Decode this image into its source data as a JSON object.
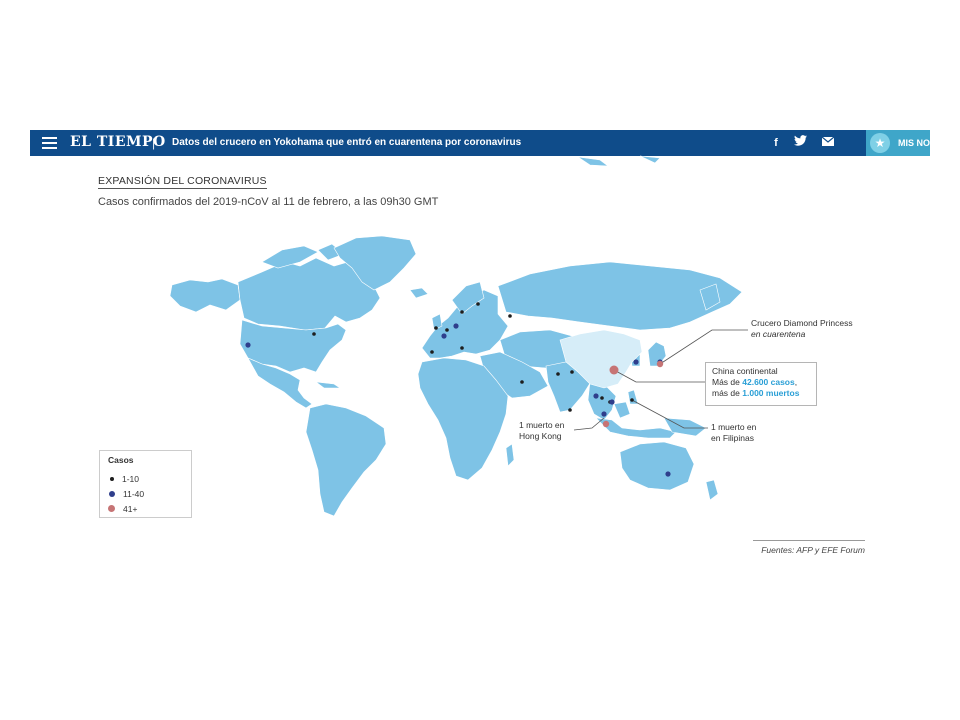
{
  "topbar": {
    "brand": "EL TIEMPO",
    "separator": "|",
    "headline": "Datos del crucero en Yokohama que entró en cuarentena por coronavirus",
    "facebook_icon": "facebook-icon",
    "twitter_icon": "twitter-icon",
    "mail_icon": "mail-icon",
    "mis_noticias_label": "MIS NO",
    "colors": {
      "bar": "#0f4c8a",
      "accent": "#3fa6c9"
    }
  },
  "card": {
    "title": "EXPANSIÓN DEL CORONAVIRUS",
    "subtitle": "Casos confirmados del 2019-nCoV al 11 de febrero, a las 09h30 GMT"
  },
  "map": {
    "colors": {
      "land": "#7ec3e6",
      "china": "#d6edf8",
      "small": "#1e1e1e",
      "medium": "#2f3e8c",
      "large": "#c67475"
    }
  },
  "callouts": {
    "diamond_line1": "Crucero Diamond Princess",
    "diamond_line2": "en cuarentena",
    "china_line1": "China continental",
    "china_line2_pre": "Más de ",
    "china_cases": "42.600 casos",
    "china_line2_post": ",",
    "china_line3_pre": "más de ",
    "china_deaths": "1.000 muertos",
    "hk_line1": "1 muerto en",
    "hk_line2": "Hong Kong",
    "ph_line1": "1 muerto en",
    "ph_line2": "en Filipinas"
  },
  "legend": {
    "title": "Casos",
    "items": [
      {
        "label": "1-10",
        "category": "small"
      },
      {
        "label": "11-40",
        "category": "medium"
      },
      {
        "label": "41+",
        "category": "large"
      }
    ]
  },
  "sources": "Fuentes: AFP y EFE Forum"
}
